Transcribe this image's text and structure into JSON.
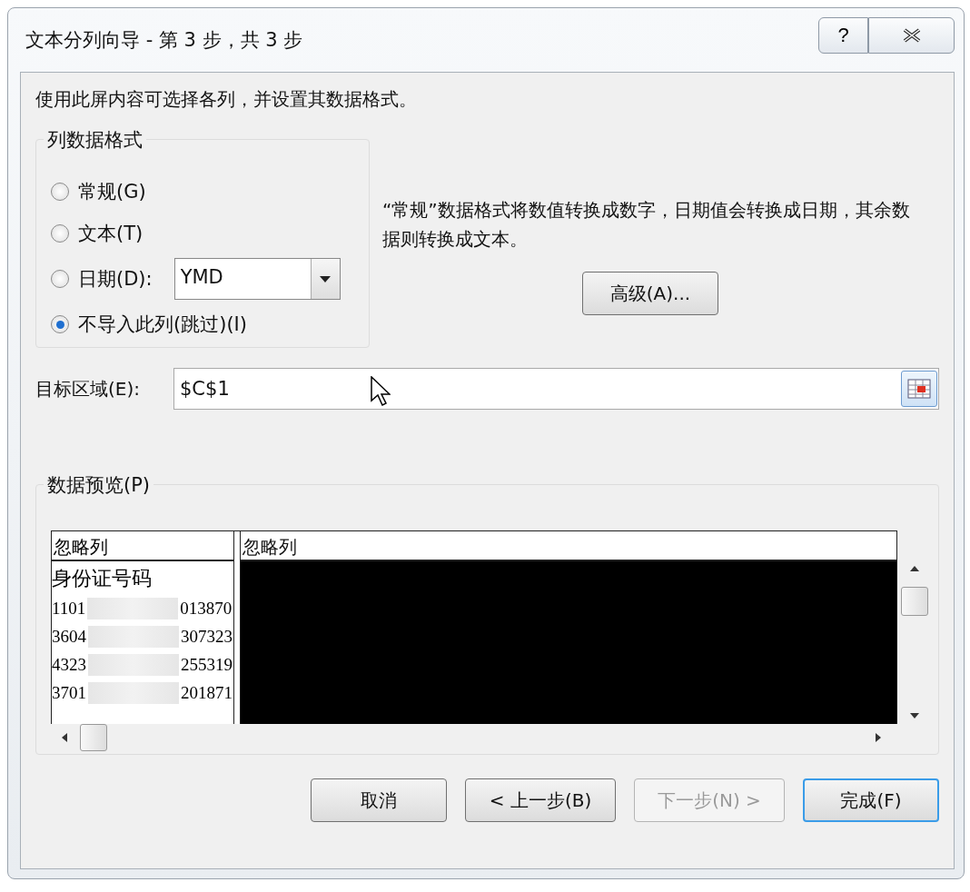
{
  "window": {
    "title": "文本分列向导 - 第 3 步，共 3 步",
    "help": "?"
  },
  "instruction": "使用此屏内容可选择各列，并设置其数据格式。",
  "format_group": {
    "title": "列数据格式",
    "options": [
      {
        "label": "常规(G)",
        "selected": false
      },
      {
        "label": "文本(T)",
        "selected": false
      },
      {
        "label": "日期(D):",
        "selected": false,
        "dropdown": "YMD"
      },
      {
        "label": "不导入此列(跳过)(I)",
        "selected": true
      }
    ]
  },
  "description": "“常规”数据格式将数值转换成数字，日期值会转换成日期，其余数据则转换成文本。",
  "advanced_button": "高级(A)...",
  "destination": {
    "label": "目标区域(E):",
    "value": "$C$1"
  },
  "preview": {
    "title": "数据预览(P)",
    "columns": [
      {
        "header": "忽略列",
        "selected": false
      },
      {
        "header": "忽略列",
        "selected": true
      }
    ],
    "rows": [
      {
        "prefix": "身份证号码",
        "masked": false,
        "suffix": ""
      },
      {
        "prefix": "1101",
        "masked": true,
        "suffix": "013870"
      },
      {
        "prefix": "3604",
        "masked": true,
        "suffix": "307323"
      },
      {
        "prefix": "4323",
        "masked": true,
        "suffix": "255319"
      },
      {
        "prefix": "3701",
        "masked": true,
        "suffix": "201871"
      }
    ]
  },
  "buttons": [
    {
      "label": "取消",
      "disabled": false,
      "default": false
    },
    {
      "label": "< 上一步(B)",
      "disabled": false,
      "default": false
    },
    {
      "label": "下一步(N) >",
      "disabled": true,
      "default": false
    },
    {
      "label": "完成(F)",
      "disabled": false,
      "default": true
    }
  ]
}
